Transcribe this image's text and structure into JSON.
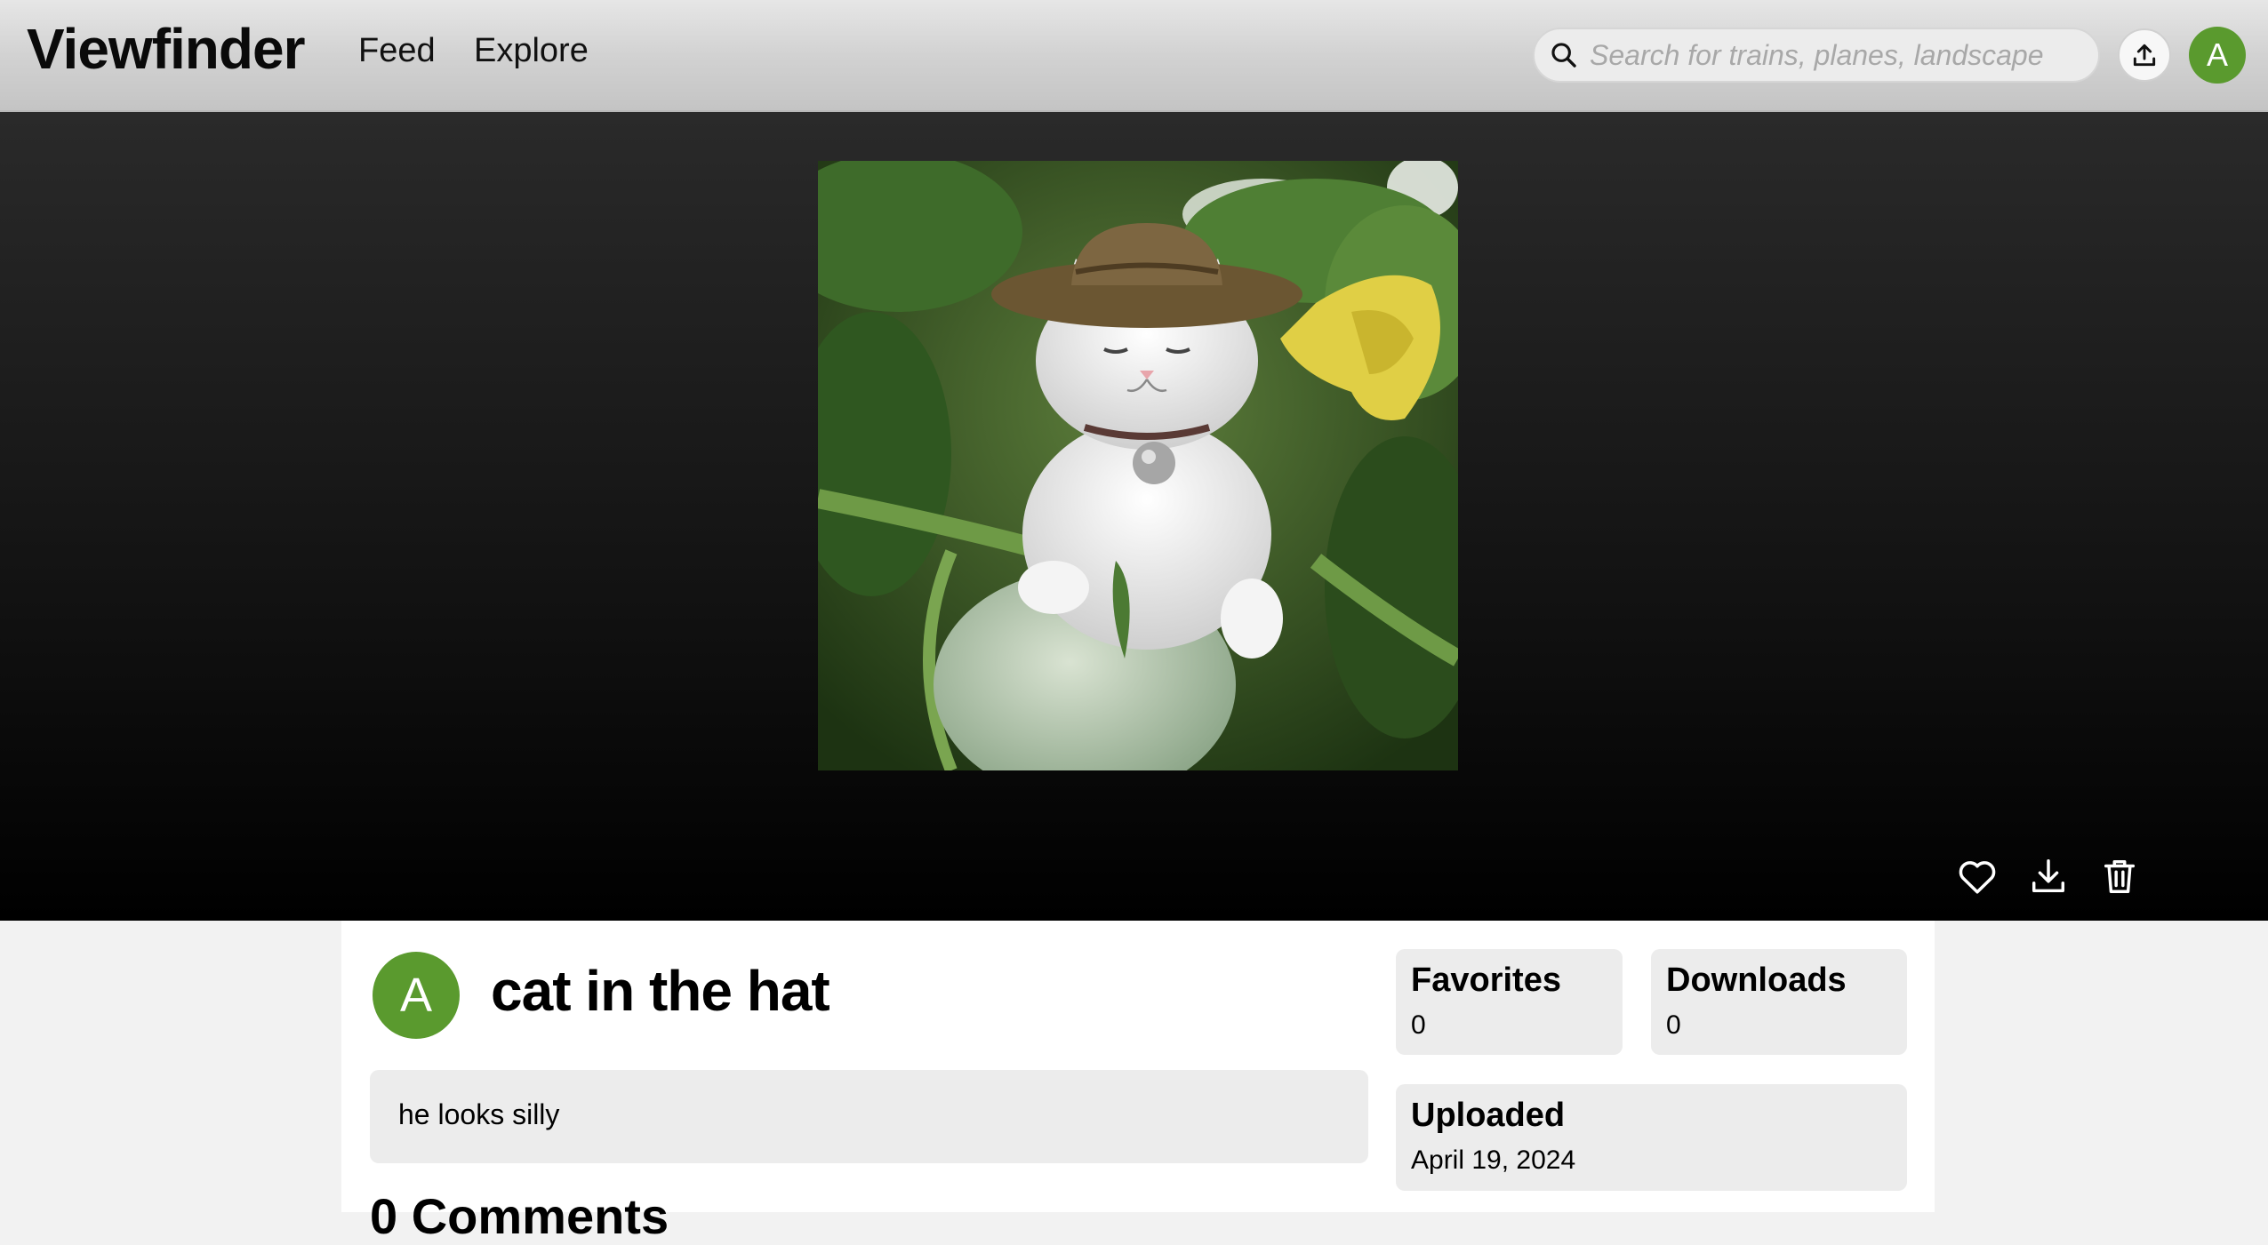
{
  "header": {
    "logo": "Viewfinder",
    "nav": {
      "feed": "Feed",
      "explore": "Explore"
    },
    "search": {
      "placeholder": "Search for trains, planes, landscape",
      "value": ""
    },
    "icons": {
      "search": "search-icon",
      "upload": "upload-icon"
    },
    "user_initial": "A"
  },
  "photo": {
    "alt": "cat in the hat",
    "actions": [
      "heart-icon",
      "download-icon",
      "trash-icon"
    ]
  },
  "details": {
    "owner_initial": "A",
    "title": "cat in the hat",
    "description": "he looks silly",
    "comments_heading": "0 Comments",
    "stats": {
      "favorites": {
        "label": "Favorites",
        "value": "0"
      },
      "downloads": {
        "label": "Downloads",
        "value": "0"
      },
      "uploaded": {
        "label": "Uploaded",
        "value": "April 19, 2024"
      }
    }
  },
  "colors": {
    "avatar": "#5a9a2e",
    "header_top": "#e6e6e6",
    "header_bottom": "#c4c4c4",
    "card_bg": "#ececec"
  }
}
